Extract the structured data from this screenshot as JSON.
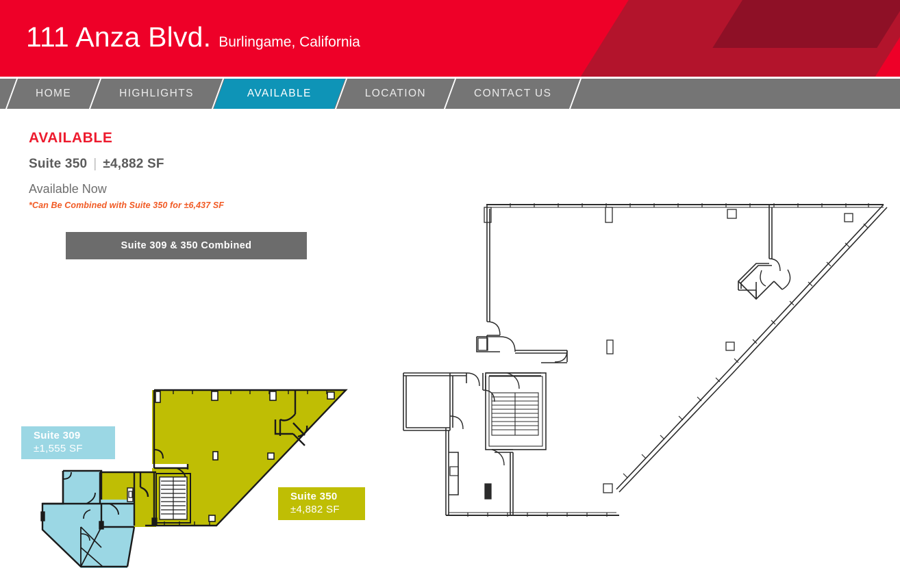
{
  "header": {
    "title": "111 Anza Blvd.",
    "subtitle": "Burlingame, California",
    "brand_red": "#EE0028",
    "brand_red_dark": "#B3142C",
    "brand_red_darkest": "#8E1026"
  },
  "nav": {
    "background": "#757575",
    "active_color": "#0E94B7",
    "items": [
      {
        "label": "HOME",
        "active": false
      },
      {
        "label": "HIGHLIGHTS",
        "active": false
      },
      {
        "label": "AVAILABLE",
        "active": true
      },
      {
        "label": "LOCATION",
        "active": false
      },
      {
        "label": "CONTACT US",
        "active": false
      }
    ]
  },
  "listing": {
    "heading": "AVAILABLE",
    "heading_color": "#ED1B2E",
    "suite_name": "Suite 350",
    "suite_divider": "|",
    "suite_size": "±4,882 SF",
    "status": "Available Now",
    "note": "*Can Be Combined with Suite 350 for ±6,437 SF",
    "note_color": "#F15A24"
  },
  "floorplan": {
    "combined_banner": "Suite 309 & 350 Combined",
    "banner_color": "#6C6C6C",
    "suite_309": {
      "name": "Suite 309",
      "size": "±1,555 SF",
      "fill": "#9BD7E4"
    },
    "suite_350": {
      "name": "Suite 350",
      "size": "±4,882 SF",
      "fill": "#BFBE04"
    },
    "outline_color": "#1A1A1A",
    "reference_plan_label": "full-floor-reference-plan"
  }
}
